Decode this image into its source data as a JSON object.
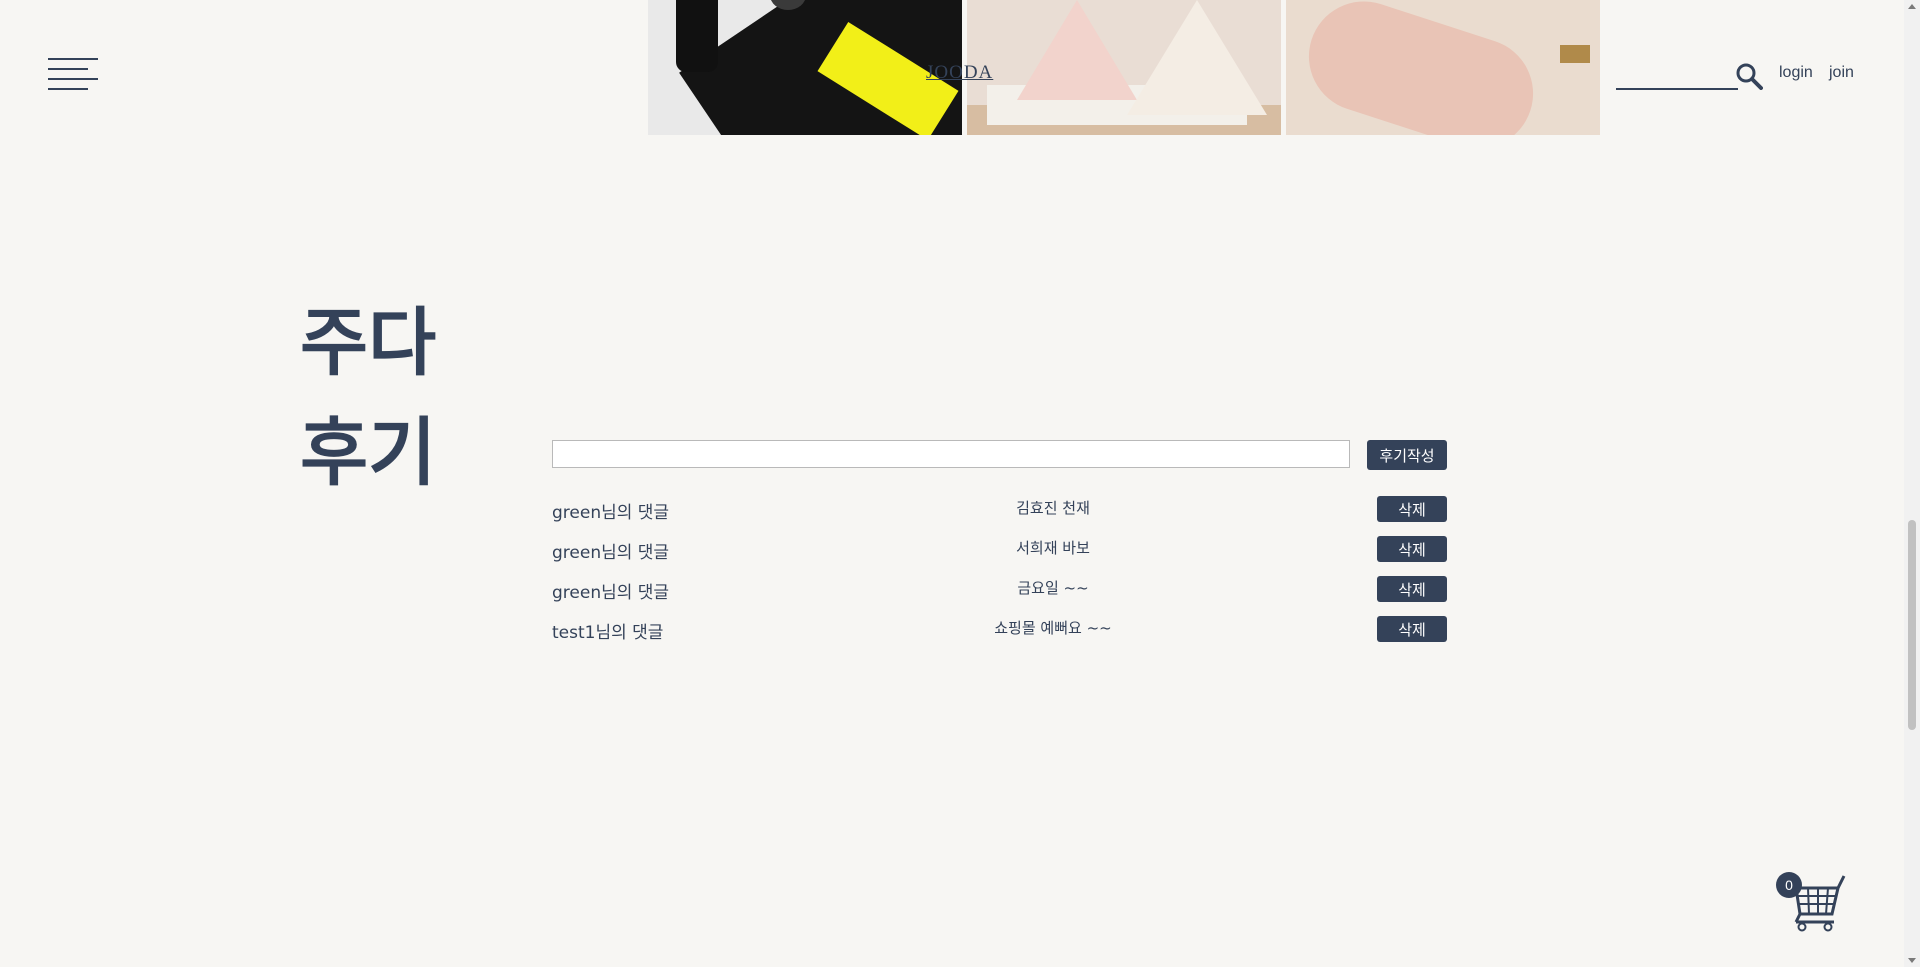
{
  "header": {
    "brand": "JOODA",
    "search_placeholder": "",
    "login": "login",
    "join": "join"
  },
  "gallery": {
    "images": [
      "mac-cosmetics-photo",
      "pet-tent-photo",
      "fabric-product-photo"
    ]
  },
  "section": {
    "title_line1": "주다",
    "title_line2": "후기"
  },
  "review_form": {
    "input_value": "",
    "submit_label": "후기작성"
  },
  "reviews": [
    {
      "author": "green님의 댓글",
      "content": "김효진 천재",
      "delete_label": "삭제"
    },
    {
      "author": "green님의 댓글",
      "content": "서희재 바보",
      "delete_label": "삭제"
    },
    {
      "author": "green님의 댓글",
      "content": "금요일 ~~",
      "delete_label": "삭제"
    },
    {
      "author": "test1님의 댓글",
      "content": "쇼핑몰 예뻐요 ~~",
      "delete_label": "삭제"
    }
  ],
  "cart": {
    "count": "0"
  },
  "colors": {
    "primary": "#344259",
    "background": "#f7f6f3"
  }
}
